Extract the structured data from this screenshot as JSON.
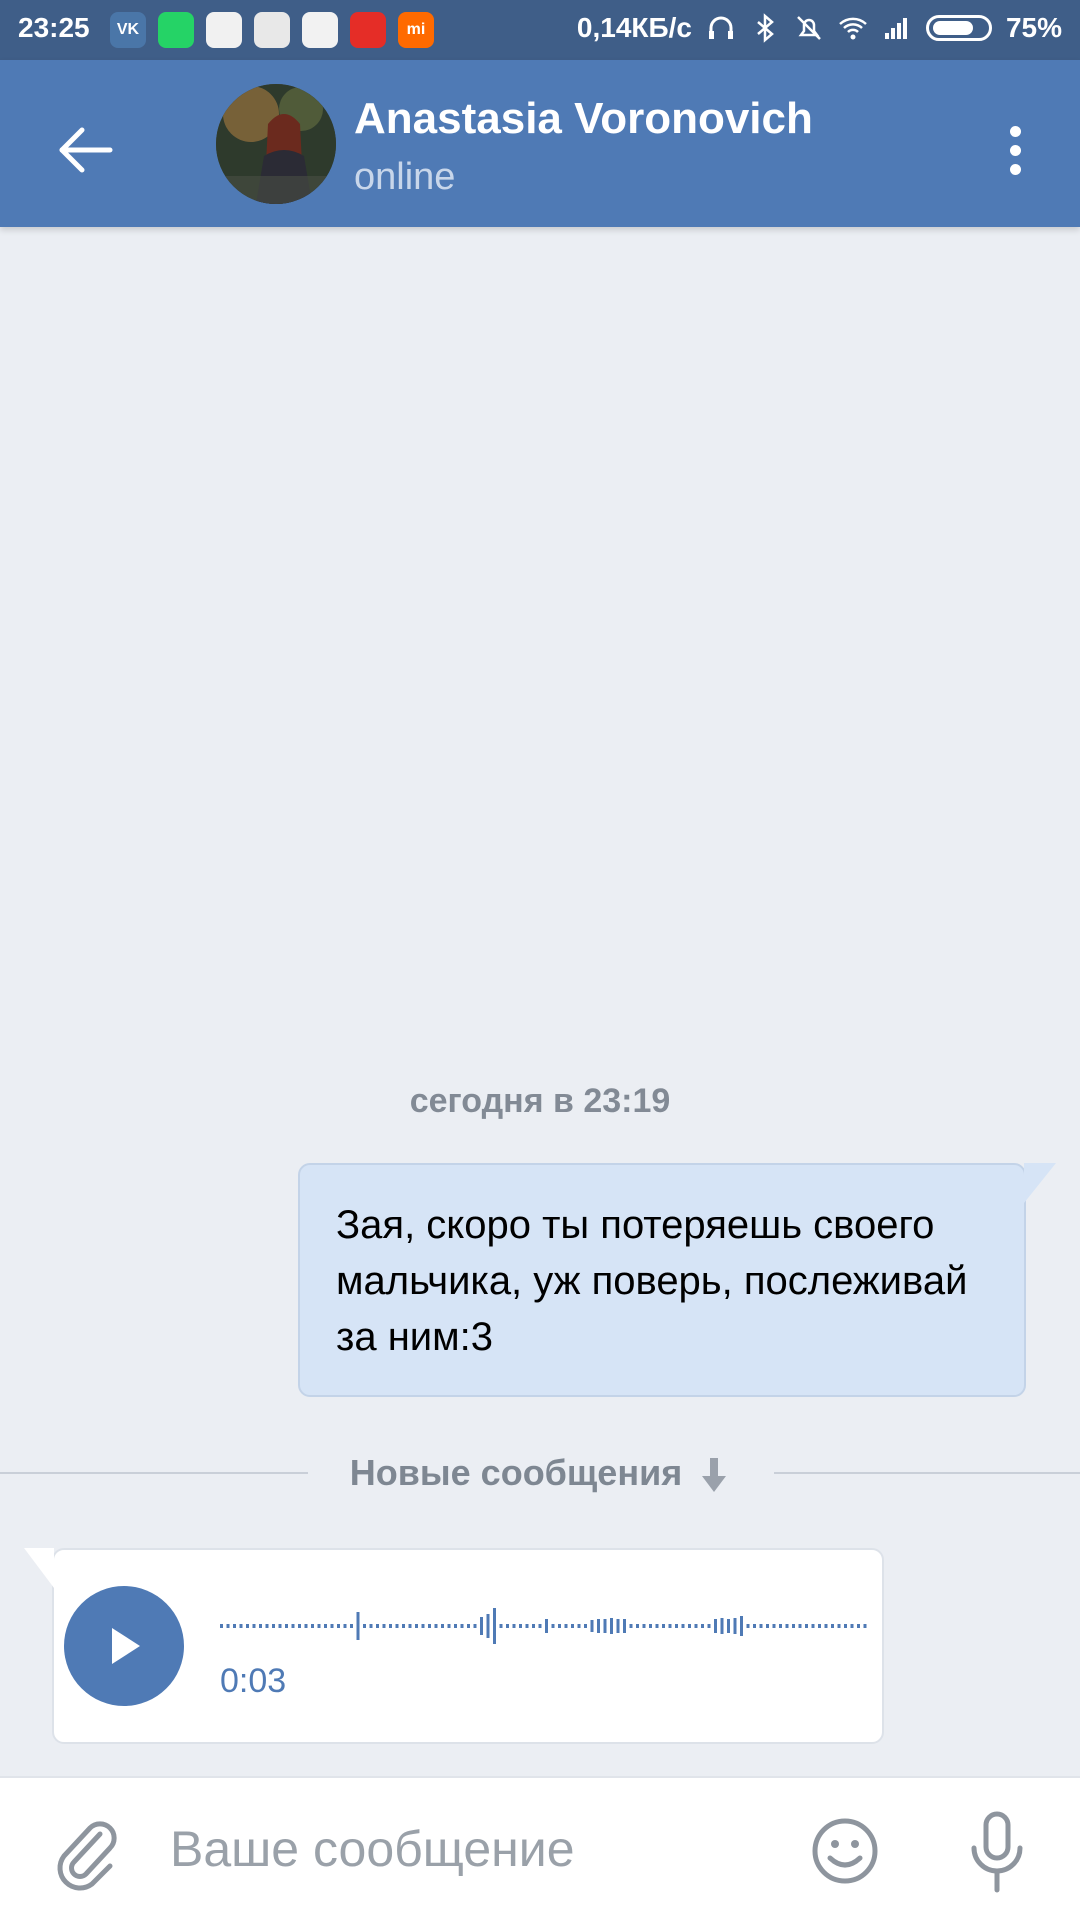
{
  "status_bar": {
    "time": "23:25",
    "app_icons": [
      {
        "name": "vk-app-icon",
        "label": "VK",
        "color": "#4a76a8"
      },
      {
        "name": "whatsapp-app-icon",
        "label": "",
        "color": "#25d366"
      },
      {
        "name": "lightning-app-icon",
        "label": "",
        "color": "#f1f1f1"
      },
      {
        "name": "chrome-app-icon",
        "label": "",
        "color": "#e8e8e8"
      },
      {
        "name": "heart-app-icon",
        "label": "",
        "color": "#f2f2f2"
      },
      {
        "name": "youtube-app-icon",
        "label": "",
        "color": "#e52d27"
      },
      {
        "name": "mi-app-icon",
        "label": "mi",
        "color": "#ff6a00"
      }
    ],
    "net_speed": "0,14КБ/с",
    "battery_percent": "75%",
    "battery_level": 0.75
  },
  "header": {
    "contact_name": "Anastasia Voronovich",
    "contact_status": "online",
    "colors": {
      "bar": "#4f7ab5"
    }
  },
  "chat": {
    "date_label": "сегодня в 23:19",
    "outgoing_message": "Зая, скоро ты потеряешь своего мальчика, уж поверь, послеживай за ним:3",
    "new_messages_label": "Новые сообщения",
    "voice_message": {
      "duration": "0:03"
    }
  },
  "input": {
    "placeholder": "Ваше сообщение",
    "value": ""
  }
}
